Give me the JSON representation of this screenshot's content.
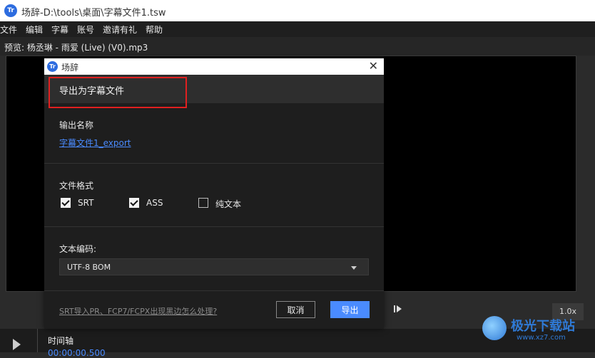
{
  "window": {
    "icon_text": "Tr",
    "title": "场辞-D:\\tools\\桌面\\字幕文件1.tsw"
  },
  "menu": {
    "items": [
      "文件",
      "编辑",
      "字幕",
      "账号",
      "邀请有礼",
      "帮助"
    ]
  },
  "preview": {
    "label": "预览: 杨丞琳 - 雨爱 (Live) (V0).mp3"
  },
  "player": {
    "speed": "1.0x"
  },
  "timeline": {
    "label": "时间轴",
    "timecode": "00:00:00.500"
  },
  "dialog": {
    "icon_text": "Tr",
    "title": "场辞",
    "close_glyph": "✕",
    "heading": "导出为字幕文件",
    "output_name_label": "输出名称",
    "output_name_value": "字幕文件1_export",
    "format_label": "文件格式",
    "formats": [
      {
        "label": "SRT",
        "checked": true
      },
      {
        "label": "ASS",
        "checked": true
      },
      {
        "label": "纯文本",
        "checked": false
      }
    ],
    "encoding_label": "文本编码:",
    "encoding_value": "UTF-8 BOM",
    "help_link": "SRT导入PR、FCP7/FCPX出现黑边怎么处理?",
    "cancel_label": "取消",
    "export_label": "导出"
  },
  "watermark": {
    "text": "极光下载站",
    "sub": "www.xz7.com"
  },
  "colors": {
    "accent": "#4a8bff",
    "highlight_box": "#e02020"
  }
}
